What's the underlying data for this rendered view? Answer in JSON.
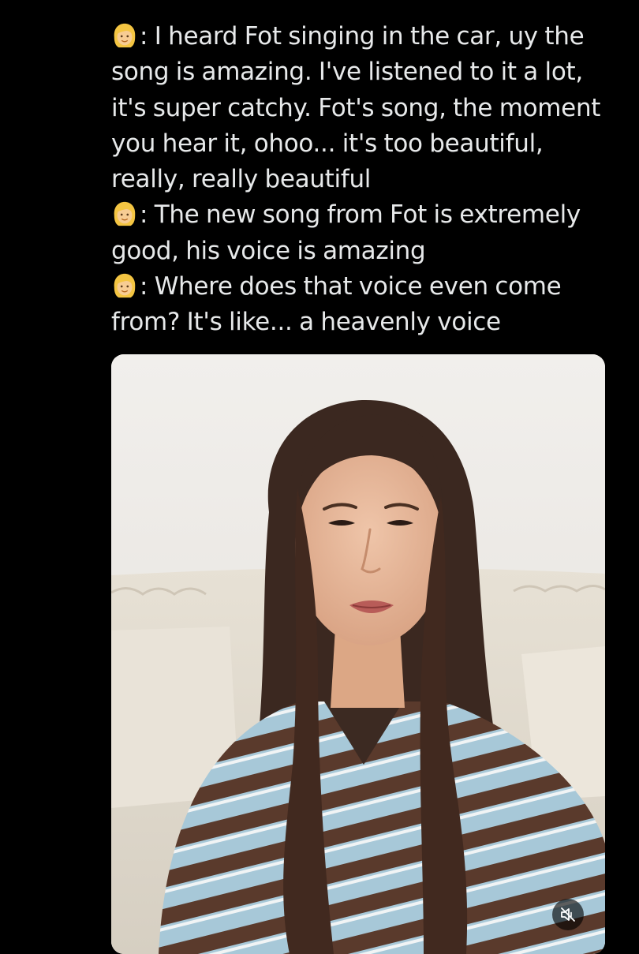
{
  "tweet": {
    "quotes": [
      {
        "emoji": "woman-blonde-emoji",
        "lines": [
          ": I heard Fot singing in the car, uy the",
          "song is amazing. I've listened to it a lot,",
          "it's super catchy. Fot's song, the moment",
          "you hear it, ohoo...  it's too beautiful,",
          "really, really beautiful"
        ]
      },
      {
        "emoji": "woman-blonde-emoji",
        "lines": [
          ": The new song from Fot is extremely",
          "good, his voice is amazing"
        ]
      },
      {
        "emoji": "woman-blonde-emoji",
        "lines": [
          ": Where does that voice even come",
          "from? It's like... a heavenly voice"
        ]
      }
    ]
  },
  "media": {
    "type": "video",
    "mute_icon": "speaker-muted-icon"
  },
  "colors": {
    "background": "#000000",
    "text": "#e7e9ea",
    "overlay_button": "#000000"
  }
}
